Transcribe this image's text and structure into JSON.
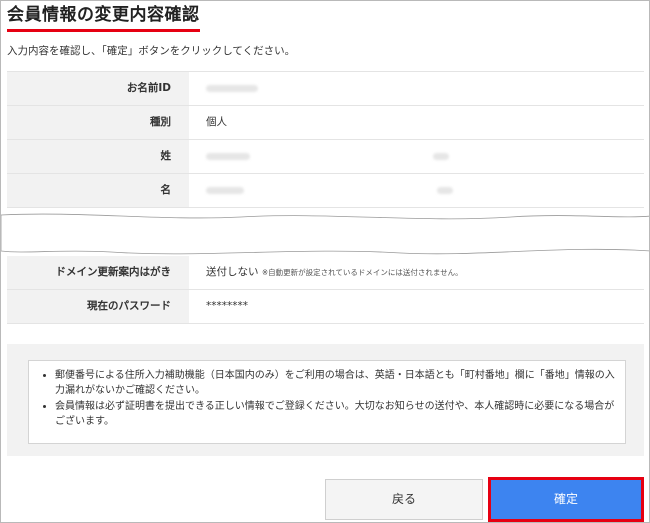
{
  "page": {
    "title": "会員情報の変更内容確認",
    "instruction": "入力内容を確認し、「確定」ボタンをクリックしてください。"
  },
  "fields_top": [
    {
      "label": "お名前ID",
      "value": ""
    },
    {
      "label": "種別",
      "value": "個人"
    },
    {
      "label": "姓",
      "value": ""
    },
    {
      "label": "名",
      "value": ""
    }
  ],
  "fields_bottom": [
    {
      "label": "ドメイン更新案内はがき",
      "value": "送付しない",
      "note": "※自動更新が設定されているドメインには送付されません。"
    },
    {
      "label": "現在のパスワード",
      "value": "********"
    }
  ],
  "notes": [
    "郵便番号による住所入力補助機能（日本国内のみ）をご利用の場合は、英語・日本語とも「町村番地」欄に「番地」情報の入力漏れがないかご確認ください。",
    "会員情報は必ず証明書を提出できる正しい情報でご登録ください。大切なお知らせの送付や、本人確認時に必要になる場合がございます。"
  ],
  "buttons": {
    "back": "戻る",
    "confirm": "確定"
  },
  "colors": {
    "accent_red": "#e60012",
    "confirm_blue": "#3d84f0",
    "label_bg": "#f2f2f2"
  }
}
